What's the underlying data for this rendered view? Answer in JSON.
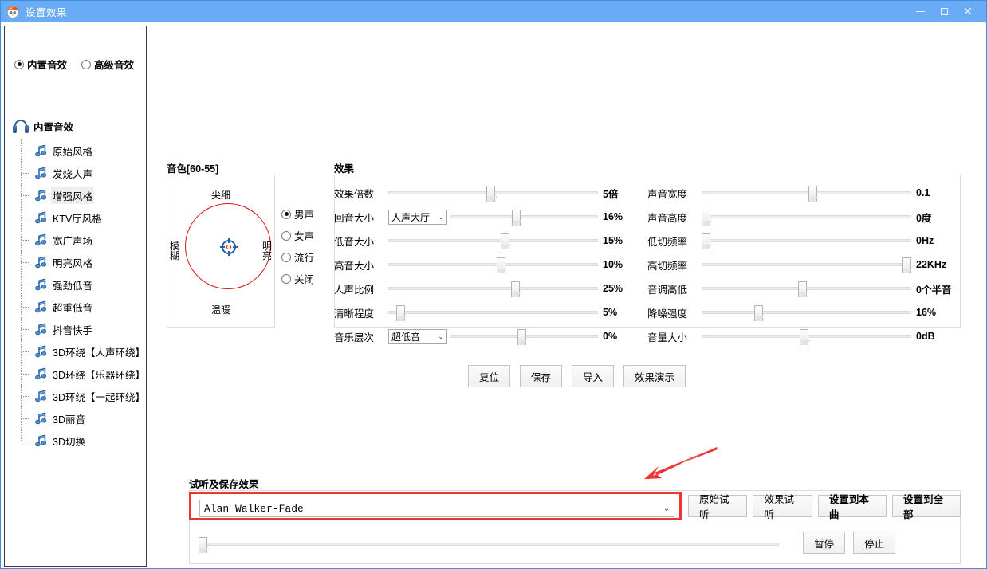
{
  "window": {
    "title": "设置效果",
    "icon": "app-icon",
    "minimize": "–",
    "maximize": "□",
    "close": "✕"
  },
  "sidebar": {
    "modes": [
      {
        "label": "内置音效",
        "selected": true
      },
      {
        "label": "高级音效",
        "selected": false
      }
    ],
    "group_title": "内置音效",
    "items": [
      {
        "label": "原始风格",
        "selected": false
      },
      {
        "label": "发烧人声",
        "selected": false
      },
      {
        "label": "增强风格",
        "selected": true
      },
      {
        "label": "KTV厅风格",
        "selected": false
      },
      {
        "label": "宽广声场",
        "selected": false
      },
      {
        "label": "明亮风格",
        "selected": false
      },
      {
        "label": "强劲低音",
        "selected": false
      },
      {
        "label": "超重低音",
        "selected": false
      },
      {
        "label": "抖音快手",
        "selected": false
      },
      {
        "label": "3D环绕【人声环绕】",
        "selected": false
      },
      {
        "label": "3D环绕【乐器环绕】",
        "selected": false
      },
      {
        "label": "3D环绕【一起环绕】",
        "selected": false
      },
      {
        "label": "3D丽音",
        "selected": false
      },
      {
        "label": "3D切换",
        "selected": false
      }
    ]
  },
  "timbre": {
    "title": "音色[60-55]",
    "axis_top": "尖细",
    "axis_bottom": "温暖",
    "axis_left": "模糊",
    "axis_right": "明亮",
    "voices": [
      {
        "label": "男声",
        "selected": true
      },
      {
        "label": "女声",
        "selected": false
      },
      {
        "label": "流行",
        "selected": false
      },
      {
        "label": "关闭",
        "selected": false
      }
    ]
  },
  "effects": {
    "title": "效果",
    "left": [
      {
        "name": "效果倍数",
        "combo": null,
        "value": "5倍",
        "pos": 49
      },
      {
        "name": "回音大小",
        "combo": "人声大厅",
        "value": "16%",
        "pos": 44
      },
      {
        "name": "低音大小",
        "combo": null,
        "value": "15%",
        "pos": 56
      },
      {
        "name": "高音大小",
        "combo": null,
        "value": "10%",
        "pos": 54
      },
      {
        "name": "人声比例",
        "combo": null,
        "value": "25%",
        "pos": 61
      },
      {
        "name": "清晰程度",
        "combo": null,
        "value": "5%",
        "pos": 4
      },
      {
        "name": "音乐层次",
        "combo": "超低音",
        "value": "0%",
        "pos": 48
      }
    ],
    "right": [
      {
        "name": "声音宽度",
        "combo": null,
        "value": "0.1",
        "pos": 53
      },
      {
        "name": "声音高度",
        "combo": null,
        "value": "0度",
        "pos": 0
      },
      {
        "name": "低切频率",
        "combo": null,
        "value": "0Hz",
        "pos": 0
      },
      {
        "name": "高切频率",
        "combo": null,
        "value": "22KHz",
        "pos": 100
      },
      {
        "name": "音调高低",
        "combo": null,
        "value": "0个半音",
        "pos": 48
      },
      {
        "name": "降噪强度",
        "combo": null,
        "value": "16%",
        "pos": 26
      },
      {
        "name": "音量大小",
        "combo": null,
        "value": "0dB",
        "pos": 49
      }
    ]
  },
  "actions": [
    {
      "label": "复位",
      "bold": false
    },
    {
      "label": "保存",
      "bold": false
    },
    {
      "label": "导入",
      "bold": false
    },
    {
      "label": "效果演示",
      "bold": false
    }
  ],
  "preview": {
    "title": "试听及保存效果",
    "file_value": "Alan Walker-Fade",
    "dropdown_arrow": "⌄",
    "buttons": [
      {
        "label": "原始试听",
        "bold": false
      },
      {
        "label": "效果试听",
        "bold": false
      },
      {
        "label": "设置到本曲",
        "bold": true
      },
      {
        "label": "设置到全部",
        "bold": true
      }
    ],
    "seek_pos": 0,
    "transport": [
      {
        "label": "暂停",
        "bold": false
      },
      {
        "label": "停止",
        "bold": false
      }
    ]
  },
  "annotation": {
    "arrow_color": "#f03232",
    "highlight_color": "#ef3333"
  }
}
